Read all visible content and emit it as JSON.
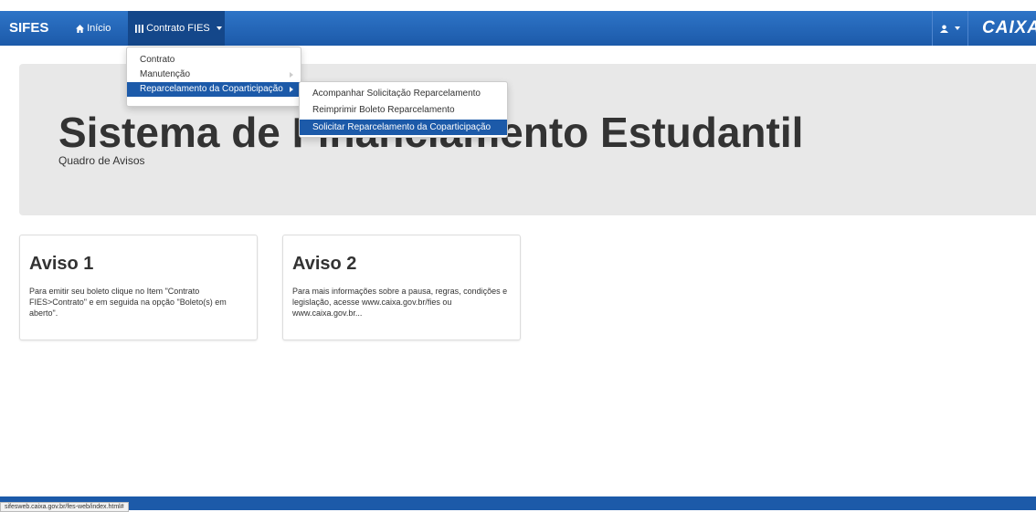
{
  "navbar": {
    "brand": "SIFES",
    "home_label": "Início",
    "contrato_label": "Contrato FIES",
    "logo": "CAIXA",
    "home_icon": "home-icon",
    "menu_icon": "bars-icon",
    "user_icon": "user-icon"
  },
  "jumbotron": {
    "title": "Sistema de Financiamento Estudantil",
    "subtitle": "Quadro de Avisos"
  },
  "dropdown": {
    "items": [
      "Contrato",
      "Manutenção",
      "Reparcelamento da Coparticipação"
    ]
  },
  "submenu": {
    "items": [
      "Acompanhar Solicitação Reparcelamento",
      "Reimprimir Boleto Reparcelamento",
      "Solicitar Reparcelamento da Coparticipação"
    ]
  },
  "cards": [
    {
      "title": "Aviso 1",
      "text": "Para emitir seu boleto clique no Item \"Contrato FIES>Contrato\" e em seguida na opção \"Boleto(s) em aberto\"."
    },
    {
      "title": "Aviso 2",
      "text": "Para mais informações sobre a pausa, regras, condições e legislação, acesse www.caixa.gov.br/fies ou www.caixa.gov.br..."
    }
  ],
  "statusbar": "sifesweb.caixa.gov.br/fes-web/index.html#",
  "colors": {
    "primary": "#1c5aa9",
    "active_nav": "#14478a",
    "jumbotron_bg": "#e8e8e8"
  }
}
